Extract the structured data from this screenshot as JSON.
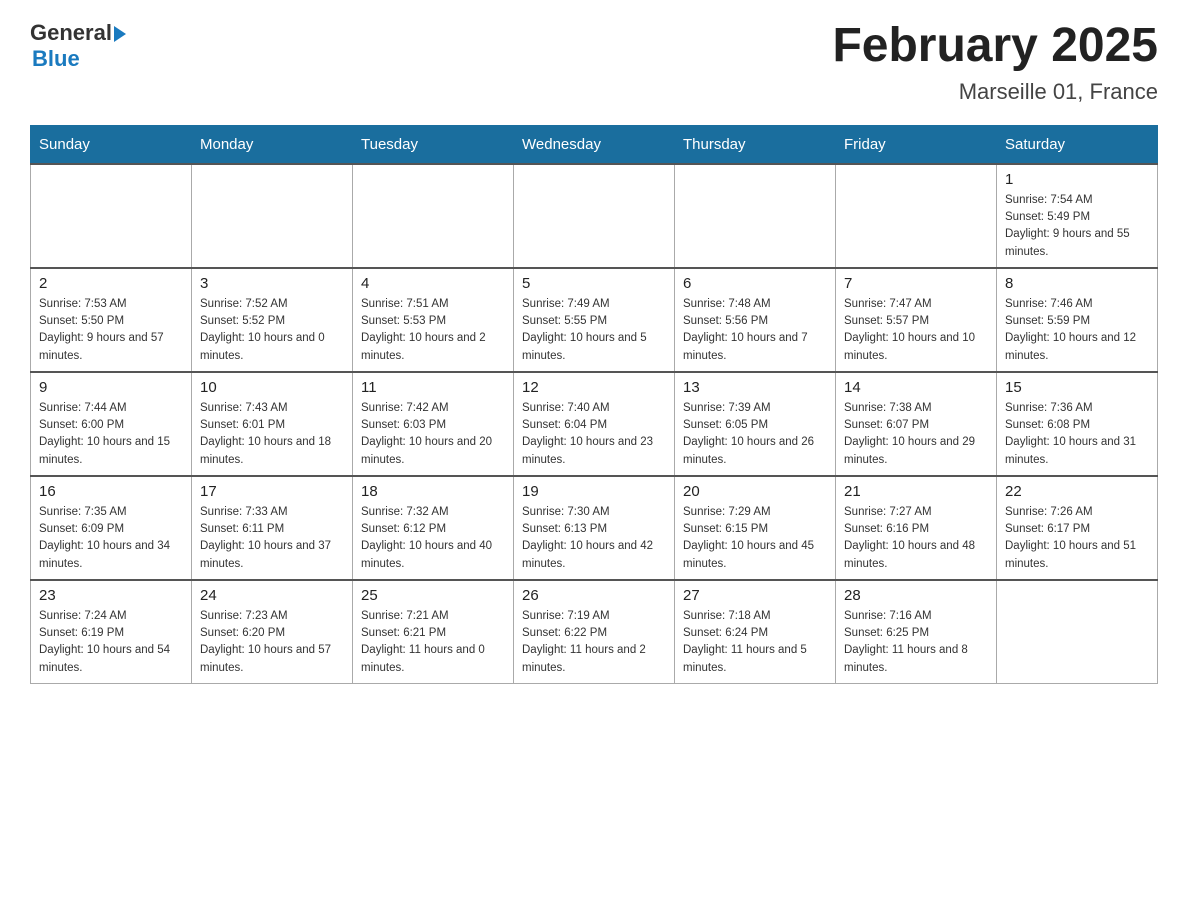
{
  "logo": {
    "general": "General",
    "blue": "Blue"
  },
  "header": {
    "title": "February 2025",
    "location": "Marseille 01, France"
  },
  "weekdays": [
    "Sunday",
    "Monday",
    "Tuesday",
    "Wednesday",
    "Thursday",
    "Friday",
    "Saturday"
  ],
  "weeks": [
    [
      {
        "day": "",
        "sunrise": "",
        "sunset": "",
        "daylight": ""
      },
      {
        "day": "",
        "sunrise": "",
        "sunset": "",
        "daylight": ""
      },
      {
        "day": "",
        "sunrise": "",
        "sunset": "",
        "daylight": ""
      },
      {
        "day": "",
        "sunrise": "",
        "sunset": "",
        "daylight": ""
      },
      {
        "day": "",
        "sunrise": "",
        "sunset": "",
        "daylight": ""
      },
      {
        "day": "",
        "sunrise": "",
        "sunset": "",
        "daylight": ""
      },
      {
        "day": "1",
        "sunrise": "Sunrise: 7:54 AM",
        "sunset": "Sunset: 5:49 PM",
        "daylight": "Daylight: 9 hours and 55 minutes."
      }
    ],
    [
      {
        "day": "2",
        "sunrise": "Sunrise: 7:53 AM",
        "sunset": "Sunset: 5:50 PM",
        "daylight": "Daylight: 9 hours and 57 minutes."
      },
      {
        "day": "3",
        "sunrise": "Sunrise: 7:52 AM",
        "sunset": "Sunset: 5:52 PM",
        "daylight": "Daylight: 10 hours and 0 minutes."
      },
      {
        "day": "4",
        "sunrise": "Sunrise: 7:51 AM",
        "sunset": "Sunset: 5:53 PM",
        "daylight": "Daylight: 10 hours and 2 minutes."
      },
      {
        "day": "5",
        "sunrise": "Sunrise: 7:49 AM",
        "sunset": "Sunset: 5:55 PM",
        "daylight": "Daylight: 10 hours and 5 minutes."
      },
      {
        "day": "6",
        "sunrise": "Sunrise: 7:48 AM",
        "sunset": "Sunset: 5:56 PM",
        "daylight": "Daylight: 10 hours and 7 minutes."
      },
      {
        "day": "7",
        "sunrise": "Sunrise: 7:47 AM",
        "sunset": "Sunset: 5:57 PM",
        "daylight": "Daylight: 10 hours and 10 minutes."
      },
      {
        "day": "8",
        "sunrise": "Sunrise: 7:46 AM",
        "sunset": "Sunset: 5:59 PM",
        "daylight": "Daylight: 10 hours and 12 minutes."
      }
    ],
    [
      {
        "day": "9",
        "sunrise": "Sunrise: 7:44 AM",
        "sunset": "Sunset: 6:00 PM",
        "daylight": "Daylight: 10 hours and 15 minutes."
      },
      {
        "day": "10",
        "sunrise": "Sunrise: 7:43 AM",
        "sunset": "Sunset: 6:01 PM",
        "daylight": "Daylight: 10 hours and 18 minutes."
      },
      {
        "day": "11",
        "sunrise": "Sunrise: 7:42 AM",
        "sunset": "Sunset: 6:03 PM",
        "daylight": "Daylight: 10 hours and 20 minutes."
      },
      {
        "day": "12",
        "sunrise": "Sunrise: 7:40 AM",
        "sunset": "Sunset: 6:04 PM",
        "daylight": "Daylight: 10 hours and 23 minutes."
      },
      {
        "day": "13",
        "sunrise": "Sunrise: 7:39 AM",
        "sunset": "Sunset: 6:05 PM",
        "daylight": "Daylight: 10 hours and 26 minutes."
      },
      {
        "day": "14",
        "sunrise": "Sunrise: 7:38 AM",
        "sunset": "Sunset: 6:07 PM",
        "daylight": "Daylight: 10 hours and 29 minutes."
      },
      {
        "day": "15",
        "sunrise": "Sunrise: 7:36 AM",
        "sunset": "Sunset: 6:08 PM",
        "daylight": "Daylight: 10 hours and 31 minutes."
      }
    ],
    [
      {
        "day": "16",
        "sunrise": "Sunrise: 7:35 AM",
        "sunset": "Sunset: 6:09 PM",
        "daylight": "Daylight: 10 hours and 34 minutes."
      },
      {
        "day": "17",
        "sunrise": "Sunrise: 7:33 AM",
        "sunset": "Sunset: 6:11 PM",
        "daylight": "Daylight: 10 hours and 37 minutes."
      },
      {
        "day": "18",
        "sunrise": "Sunrise: 7:32 AM",
        "sunset": "Sunset: 6:12 PM",
        "daylight": "Daylight: 10 hours and 40 minutes."
      },
      {
        "day": "19",
        "sunrise": "Sunrise: 7:30 AM",
        "sunset": "Sunset: 6:13 PM",
        "daylight": "Daylight: 10 hours and 42 minutes."
      },
      {
        "day": "20",
        "sunrise": "Sunrise: 7:29 AM",
        "sunset": "Sunset: 6:15 PM",
        "daylight": "Daylight: 10 hours and 45 minutes."
      },
      {
        "day": "21",
        "sunrise": "Sunrise: 7:27 AM",
        "sunset": "Sunset: 6:16 PM",
        "daylight": "Daylight: 10 hours and 48 minutes."
      },
      {
        "day": "22",
        "sunrise": "Sunrise: 7:26 AM",
        "sunset": "Sunset: 6:17 PM",
        "daylight": "Daylight: 10 hours and 51 minutes."
      }
    ],
    [
      {
        "day": "23",
        "sunrise": "Sunrise: 7:24 AM",
        "sunset": "Sunset: 6:19 PM",
        "daylight": "Daylight: 10 hours and 54 minutes."
      },
      {
        "day": "24",
        "sunrise": "Sunrise: 7:23 AM",
        "sunset": "Sunset: 6:20 PM",
        "daylight": "Daylight: 10 hours and 57 minutes."
      },
      {
        "day": "25",
        "sunrise": "Sunrise: 7:21 AM",
        "sunset": "Sunset: 6:21 PM",
        "daylight": "Daylight: 11 hours and 0 minutes."
      },
      {
        "day": "26",
        "sunrise": "Sunrise: 7:19 AM",
        "sunset": "Sunset: 6:22 PM",
        "daylight": "Daylight: 11 hours and 2 minutes."
      },
      {
        "day": "27",
        "sunrise": "Sunrise: 7:18 AM",
        "sunset": "Sunset: 6:24 PM",
        "daylight": "Daylight: 11 hours and 5 minutes."
      },
      {
        "day": "28",
        "sunrise": "Sunrise: 7:16 AM",
        "sunset": "Sunset: 6:25 PM",
        "daylight": "Daylight: 11 hours and 8 minutes."
      },
      {
        "day": "",
        "sunrise": "",
        "sunset": "",
        "daylight": ""
      }
    ]
  ]
}
